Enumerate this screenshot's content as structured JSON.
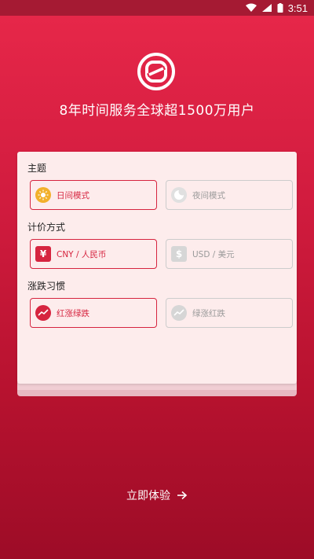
{
  "status": {
    "time": "3:51"
  },
  "header": {
    "tagline": "8年时间服务全球超1500万用户"
  },
  "sections": {
    "theme": {
      "label": "主题",
      "options": [
        "日间模式",
        "夜间模式"
      ]
    },
    "currency": {
      "label": "计价方式",
      "options": [
        "CNY / 人民币",
        "USD / 美元"
      ]
    },
    "color": {
      "label": "涨跌习惯",
      "options": [
        "红涨绿跌",
        "绿涨红跌"
      ]
    }
  },
  "cta": {
    "label": "立即体验"
  },
  "colors": {
    "accent": "#d6243f",
    "inactive": "#cccccc"
  }
}
